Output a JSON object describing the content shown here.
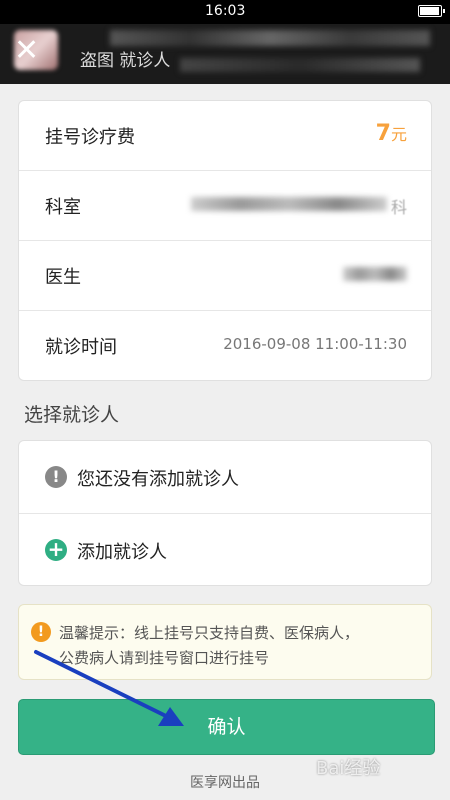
{
  "status_bar": {
    "time": "16:03",
    "battery_level": 0.85
  },
  "header": {
    "back_icon": "close-x-icon",
    "title": "盗图",
    "title_suffix": "就诊人"
  },
  "details": {
    "fee": {
      "label": "挂号诊疗费",
      "amount": "7",
      "unit": "元"
    },
    "department": {
      "label": "科室",
      "value_tail": "科"
    },
    "doctor": {
      "label": "医生"
    },
    "visit_time": {
      "label": "就诊时间",
      "value": "2016-09-08 11:00-11:30"
    }
  },
  "select_section": {
    "title": "选择就诊人",
    "empty_message": "您还没有添加就诊人",
    "add_label": "添加就诊人"
  },
  "notice": {
    "line1": "温馨提示：线上挂号只支持自费、医保病人，",
    "line2": "公费病人请到挂号窗口进行挂号"
  },
  "confirm_label": "确认",
  "footer": "医享网出品",
  "watermark": "Bai经验",
  "colors": {
    "accent": "#35b287",
    "fee": "#f7a13c",
    "warning": "#f29a1f",
    "arrow": "#1a3fbf"
  }
}
